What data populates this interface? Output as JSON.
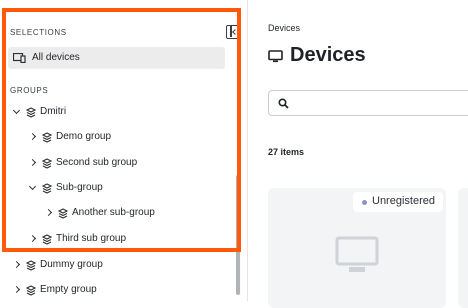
{
  "sidebar": {
    "selections_heading": "SELECTIONS",
    "all_devices_label": "All devices",
    "groups_heading": "GROUPS",
    "tree": [
      {
        "label": "Dmitri",
        "expanded": true
      },
      {
        "label": "Demo group",
        "expanded": false
      },
      {
        "label": "Second sub group",
        "expanded": false
      },
      {
        "label": "Sub-group",
        "expanded": true
      },
      {
        "label": "Another sub-group",
        "expanded": false
      },
      {
        "label": "Third sub group",
        "expanded": false
      },
      {
        "label": "Dummy group",
        "expanded": false
      },
      {
        "label": "Empty group",
        "expanded": false
      }
    ]
  },
  "main": {
    "breadcrumb": "Devices",
    "title": "Devices",
    "search_placeholder": "",
    "item_count": "27 items",
    "card": {
      "status": "Unregistered"
    }
  },
  "colors": {
    "highlight": "#ff5a0a",
    "status_dot": "#8a93c9"
  }
}
